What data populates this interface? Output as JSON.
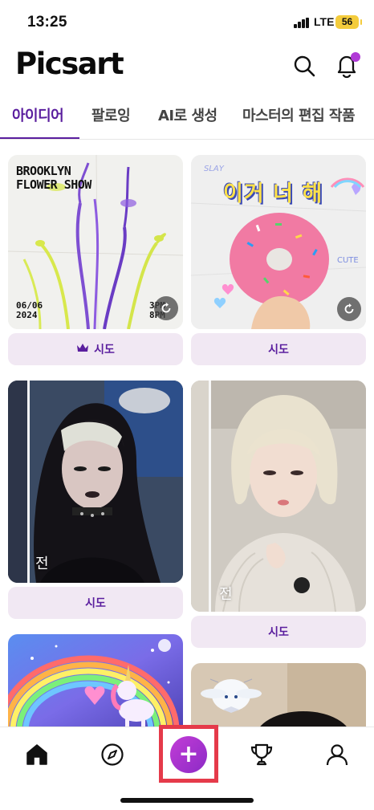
{
  "status_bar": {
    "time": "13:25",
    "network": "LTE",
    "battery": "56"
  },
  "header": {
    "logo": "Picsart",
    "search_icon": "search-icon",
    "bell_icon": "bell-icon",
    "badge_color": "#b03ad6"
  },
  "tabs": [
    {
      "label": "아이디어",
      "active": true
    },
    {
      "label": "팔로잉",
      "active": false
    },
    {
      "label": "AI로 생성",
      "active": false
    },
    {
      "label": "마스터의 편집 작품",
      "active": false
    }
  ],
  "feed": {
    "left": [
      {
        "title_line1": "BROOKLYN",
        "title_line2": "FLOWER SHOW",
        "date_line1": "06/06",
        "date_line2": "2024",
        "time_line1": "3PM",
        "time_line2": "8PM",
        "button": "시도",
        "premium": true
      },
      {
        "before_label": "전",
        "button": "시도"
      },
      {
        "type": "unicorn"
      }
    ],
    "right": [
      {
        "overlay_text": "이거 너 해",
        "sticker_top": "SLAY",
        "sticker_right": "CUTE",
        "button": "시도"
      },
      {
        "before_label": "전",
        "button": "시도"
      },
      {
        "type": "cinnamoroll"
      }
    ]
  },
  "bottom_nav": {
    "items": [
      "home-icon",
      "explore-icon",
      "create-icon",
      "challenges-icon",
      "profile-icon"
    ],
    "create_symbol": "+"
  },
  "colors": {
    "accent": "#5a1e9e",
    "button_bg": "#f1e8f3",
    "highlight": "#e53a4a"
  }
}
